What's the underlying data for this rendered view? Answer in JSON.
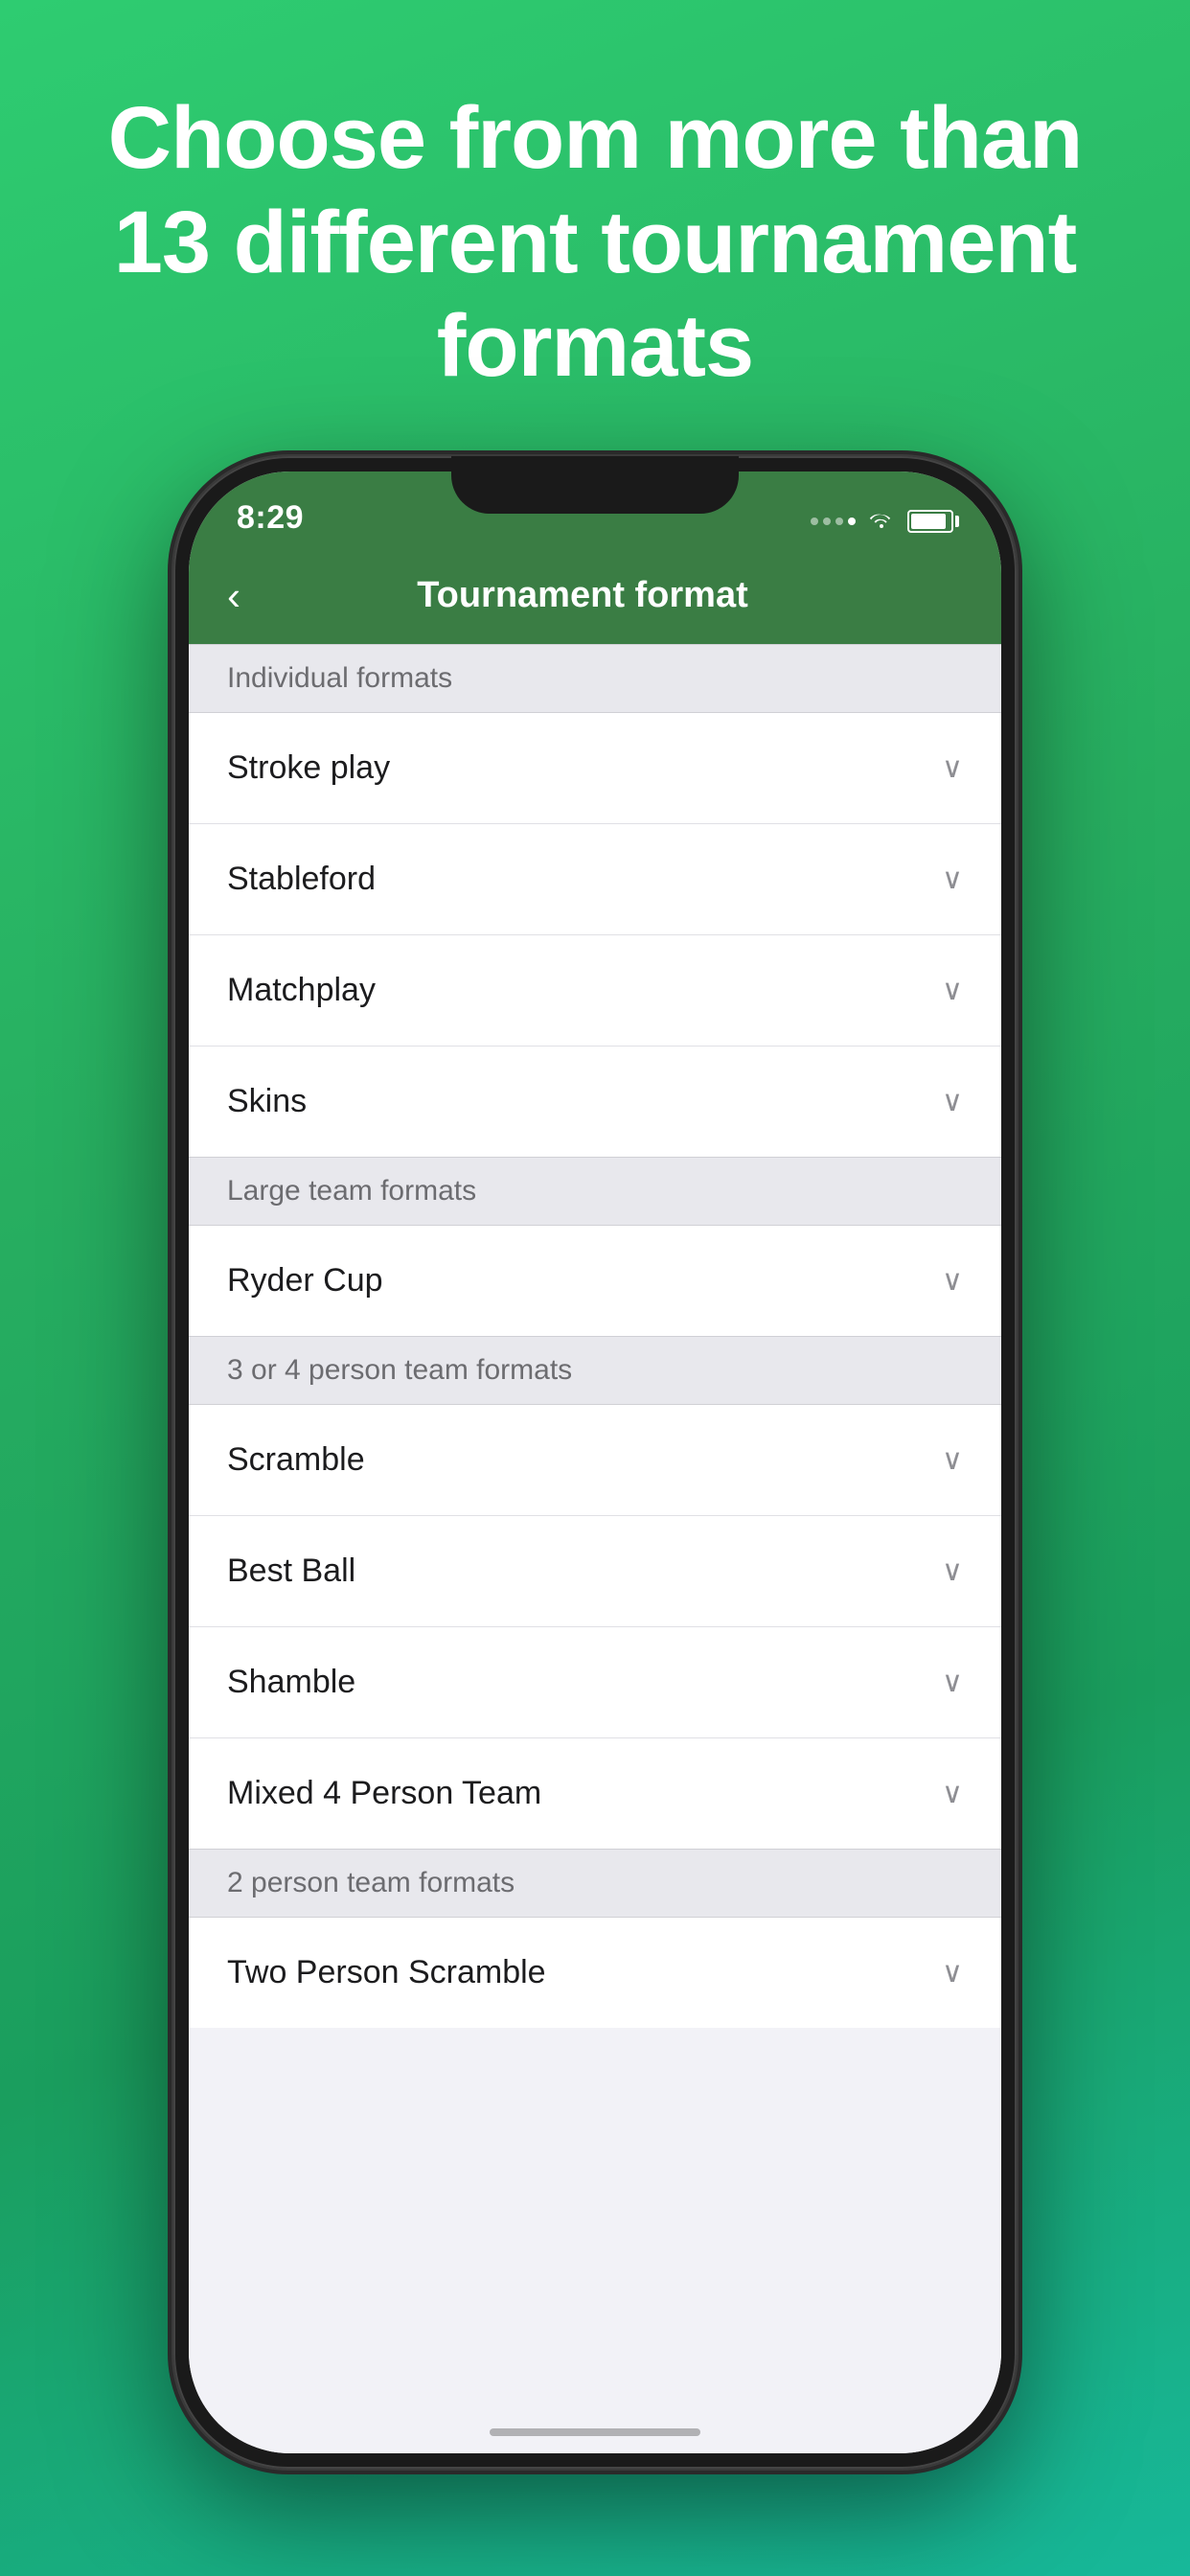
{
  "hero": {
    "text": "Choose from more than 13 different tournament formats"
  },
  "statusBar": {
    "time": "8:29",
    "batteryLabel": "battery"
  },
  "navBar": {
    "backLabel": "‹",
    "title": "Tournament format"
  },
  "sections": [
    {
      "id": "individual-formats",
      "header": "Individual formats",
      "items": [
        {
          "id": "stroke-play",
          "label": "Stroke play"
        },
        {
          "id": "stableford",
          "label": "Stableford"
        },
        {
          "id": "matchplay",
          "label": "Matchplay"
        },
        {
          "id": "skins",
          "label": "Skins"
        }
      ]
    },
    {
      "id": "large-team-formats",
      "header": "Large team formats",
      "items": [
        {
          "id": "ryder-cup",
          "label": "Ryder Cup"
        }
      ]
    },
    {
      "id": "three-or-four-person-team-formats",
      "header": "3 or 4 person team formats",
      "items": [
        {
          "id": "scramble",
          "label": "Scramble"
        },
        {
          "id": "best-ball",
          "label": "Best Ball"
        },
        {
          "id": "shamble",
          "label": "Shamble"
        },
        {
          "id": "mixed-4-person-team",
          "label": "Mixed 4 Person Team"
        }
      ]
    },
    {
      "id": "two-person-team-formats",
      "header": "2 person team formats",
      "items": [
        {
          "id": "two-person-scramble",
          "label": "Two Person Scramble"
        }
      ]
    }
  ],
  "chevron": "∨",
  "colors": {
    "green": "#3a7d44",
    "background": "#f2f2f7",
    "sectionBg": "#e8e8ed",
    "textPrimary": "#1c1c1e",
    "textSecondary": "#6c6c70"
  }
}
